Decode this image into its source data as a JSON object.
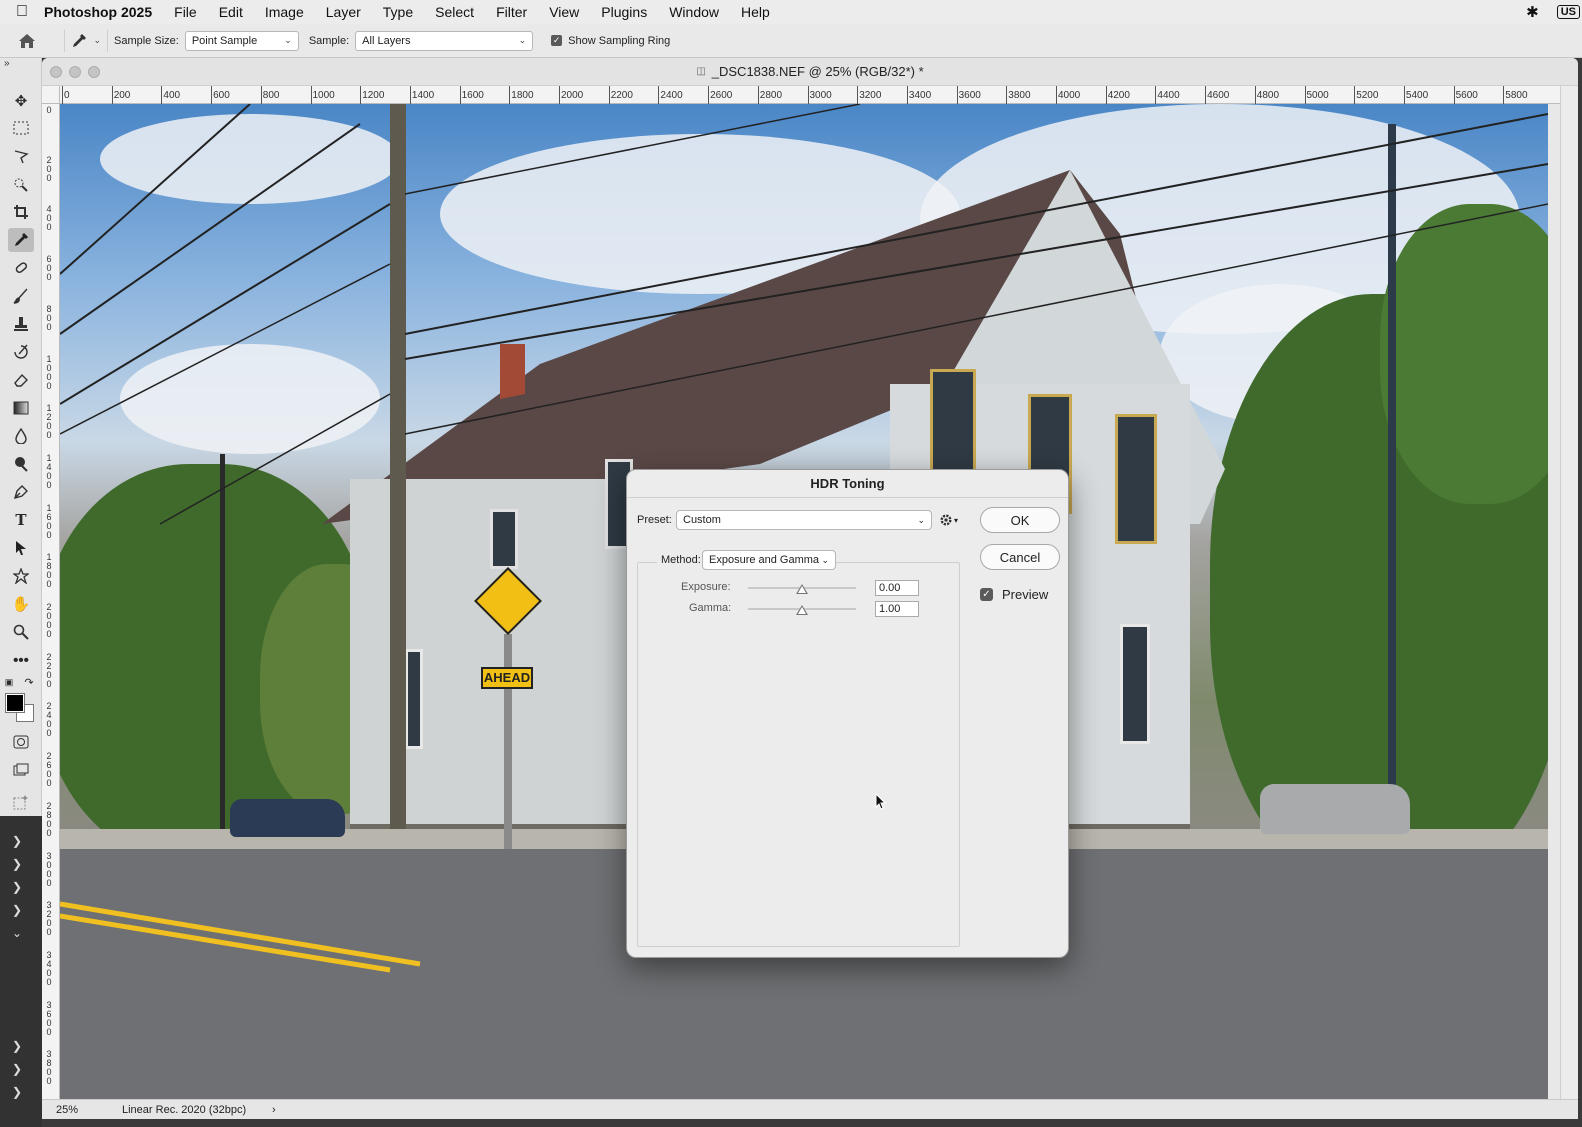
{
  "menubar": {
    "app_name": "Photoshop 2025",
    "items": [
      "File",
      "Edit",
      "Image",
      "Layer",
      "Type",
      "Select",
      "Filter",
      "View",
      "Plugins",
      "Window",
      "Help"
    ],
    "input_source": "US"
  },
  "options_bar": {
    "sample_size_label": "Sample Size:",
    "sample_size_value": "Point Sample",
    "sample_label": "Sample:",
    "sample_value": "All Layers",
    "sampling_ring_label": "Show Sampling Ring",
    "sampling_ring_checked": true
  },
  "document": {
    "title": "_DSC1838.NEF @ 25% (RGB/32*) *",
    "ruler_h_labels": [
      "0",
      "200",
      "400",
      "600",
      "800",
      "1000",
      "1200",
      "1400",
      "1600",
      "1800",
      "2000",
      "2200",
      "2400",
      "2600",
      "2800",
      "3000",
      "3200",
      "3400",
      "3600",
      "3800",
      "4000",
      "4200",
      "4400",
      "4600",
      "4800",
      "5000",
      "5200",
      "5400",
      "5600",
      "5800"
    ],
    "ruler_v_labels": [
      "0",
      "200",
      "400",
      "600",
      "800",
      "1000",
      "1200",
      "1400",
      "1600",
      "1800",
      "2000",
      "2200",
      "2400",
      "2600",
      "2800",
      "3000",
      "3200",
      "3400",
      "3600",
      "3800"
    ],
    "zoom": "25%",
    "color_profile": "Linear Rec. 2020 (32bpc)",
    "sign_text": "AHEAD"
  },
  "dialog": {
    "title": "HDR Toning",
    "preset_label": "Preset:",
    "preset_value": "Custom",
    "method_label": "Method:",
    "method_value": "Exposure and Gamma",
    "exposure_label": "Exposure:",
    "exposure_value": "0.00",
    "gamma_label": "Gamma:",
    "gamma_value": "1.00",
    "ok_label": "OK",
    "cancel_label": "Cancel",
    "preview_label": "Preview",
    "preview_checked": true
  },
  "icons": {
    "apple": "apple-logo-icon",
    "bluetooth": "bluetooth-icon",
    "home": "home-icon",
    "eyedropper": "eyedropper-icon",
    "gear": "gear-icon"
  }
}
